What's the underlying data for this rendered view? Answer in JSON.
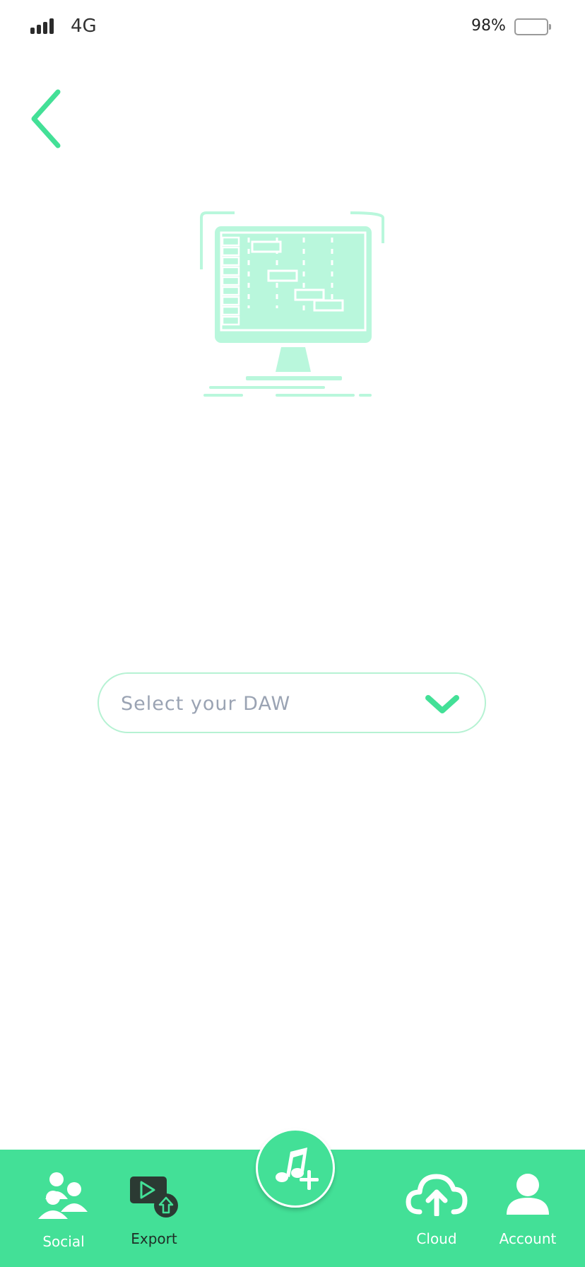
{
  "status_bar": {
    "network": "4G",
    "battery_percent": "98%",
    "signal_level": 4
  },
  "daw_select": {
    "placeholder": "Select your DAW"
  },
  "tab_bar": {
    "items": [
      {
        "label": "Social",
        "icon": "people-icon"
      },
      {
        "label": "Export",
        "icon": "export-video-icon"
      },
      {
        "label": "Cloud",
        "icon": "cloud-upload-icon"
      },
      {
        "label": "Account",
        "icon": "user-icon"
      }
    ],
    "fab_icon": "add-music-icon"
  },
  "colors": {
    "accent": "#43e097",
    "accent_light": "#b9f7dc",
    "placeholder": "#9aa3b3",
    "text_dark": "#222222"
  }
}
